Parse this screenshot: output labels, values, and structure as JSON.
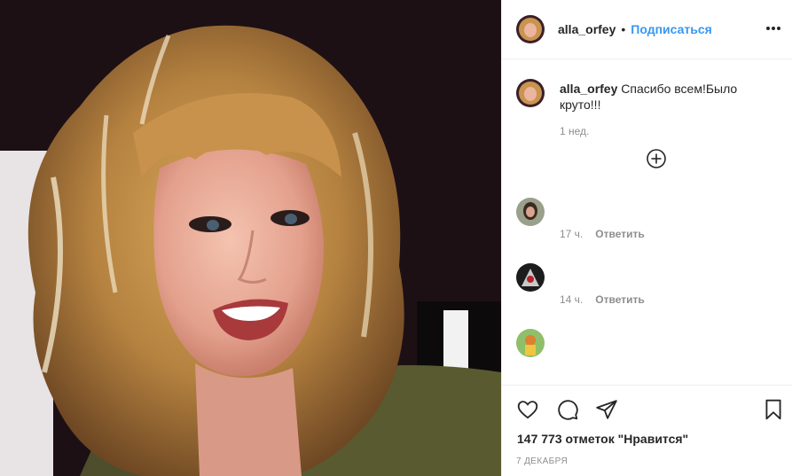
{
  "post": {
    "username": "alla_orfey",
    "separator": "•",
    "follow_label": "Подписаться",
    "more_icon": "more-horizontal-icon"
  },
  "caption": {
    "username": "alla_orfey",
    "text": "Спасибо всем!Было круто!!!",
    "time": "1 нед."
  },
  "load_more_icon": "plus-circle-icon",
  "comments": [
    {
      "time": "17 ч.",
      "reply_label": "Ответить"
    },
    {
      "time": "14 ч.",
      "reply_label": "Ответить"
    },
    {
      "time": "",
      "reply_label": ""
    }
  ],
  "actions": {
    "like_icon": "heart-icon",
    "comment_icon": "comment-icon",
    "share_icon": "paper-plane-icon",
    "save_icon": "bookmark-icon"
  },
  "likes_text": "147 773 отметок \"Нравится\"",
  "date_text": "7 ДЕКАБРЯ",
  "colors": {
    "link": "#3897f0",
    "text": "#262626",
    "muted": "#8e8e8e",
    "border": "#efefef"
  }
}
